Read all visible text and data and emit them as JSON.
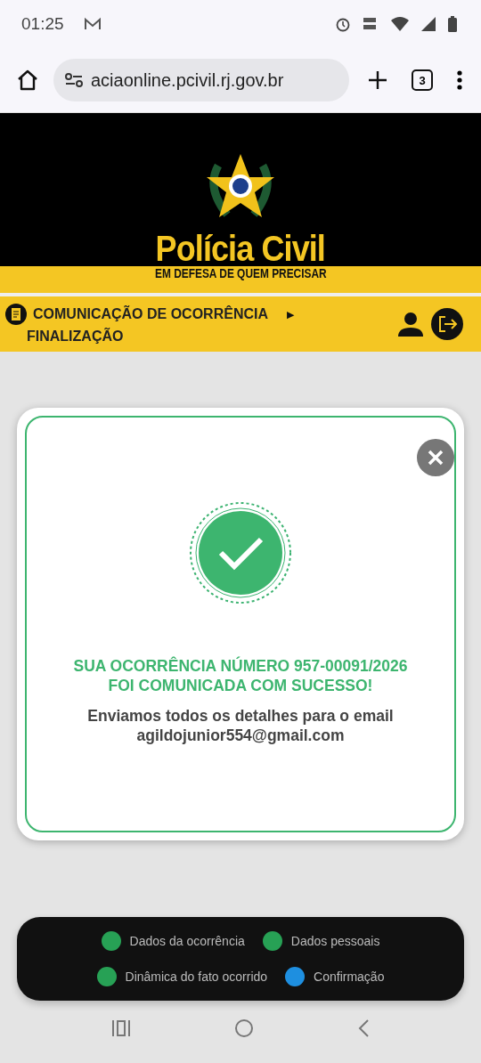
{
  "status_bar": {
    "time": "01:25"
  },
  "browser": {
    "url": "aciaonline.pcivil.rj.gov.br",
    "tab_count": "3"
  },
  "header": {
    "title": "Polícia Civil",
    "tagline": "EM DEFESA DE QUEM PRECISAR"
  },
  "nav": {
    "section": "COMUNICAÇÃO DE OCORRÊNCIA",
    "arrow": "▶",
    "step": "FINALIZAÇÃO"
  },
  "modal": {
    "title_lines": [
      "SUA OCORRÊNCIA NÚMERO 957-00091/2026",
      "FOI COMUNICADA COM SUCESSO!"
    ],
    "message": "Enviamos todos os detalhes para o email",
    "email": "agildojunior554@gmail.com"
  },
  "steps": [
    {
      "label": "Dados da ocorrência",
      "color": "#27a155"
    },
    {
      "label": "Dados pessoais",
      "color": "#27a155"
    },
    {
      "label": "Dinâmica do fato ocorrido",
      "color": "#27a155"
    },
    {
      "label": "Confirmação",
      "color": "#1e8fe0"
    }
  ]
}
